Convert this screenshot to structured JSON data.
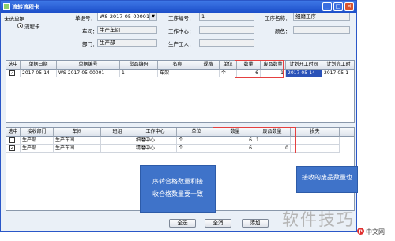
{
  "window": {
    "title": "流转流程卡"
  },
  "header": {
    "unselected_label": "未选单据",
    "radio_label": "流程卡",
    "doc_no_label": "单据号：",
    "doc_no_value": "WS-2017-05-00001",
    "process_no_label": "工序编号：",
    "process_no_value": "1",
    "process_name_label": "工序名称：",
    "process_name_value": "细磨工序",
    "workshop_label": "车间：",
    "workshop_value": "生产车间",
    "workcenter_label": "工作中心：",
    "workcenter_value": "",
    "color_label": "颜色：",
    "color_value": "",
    "dept_label": "部门：",
    "dept_value": "生产部",
    "worker_label": "生产工人：",
    "worker_value": ""
  },
  "upper_grid": {
    "columns": [
      "选中",
      "单据日期",
      "单据编号",
      "货品编码",
      "名称",
      "规格",
      "单位",
      "数量",
      "废品数量",
      "计划开工时间",
      "计划完工时"
    ],
    "rows": [
      {
        "checked": true,
        "cells": [
          "",
          "2017-05-14",
          "WS-2017-05-00001",
          "1",
          "车架",
          "",
          "个",
          "6",
          "1",
          "2017-05-14",
          "2017-05-1"
        ]
      }
    ]
  },
  "lower_grid": {
    "columns": [
      "选中",
      "接收部门",
      "车间",
      "班组",
      "工作中心",
      "单位",
      "数量",
      "废品数量",
      "损失"
    ],
    "rows": [
      {
        "checked": false,
        "cells": [
          "",
          "生产部",
          "生产车间",
          "",
          "细磨中心",
          "个",
          "6",
          "1",
          ""
        ]
      },
      {
        "checked": true,
        "cells": [
          "",
          "生产部",
          "生产车间",
          "",
          "精磨中心",
          "个",
          "6",
          "0",
          ""
        ]
      }
    ]
  },
  "annotations": {
    "callout_left": [
      "序转合格数量和接",
      "收合格数量要一致"
    ],
    "callout_right": "接收的废品数量也"
  },
  "buttons": {
    "select_all": "全选",
    "deselect_all": "全消",
    "add": "添加"
  },
  "watermark": {
    "text": "软件技巧",
    "badge": "p",
    "site": "中文网"
  }
}
